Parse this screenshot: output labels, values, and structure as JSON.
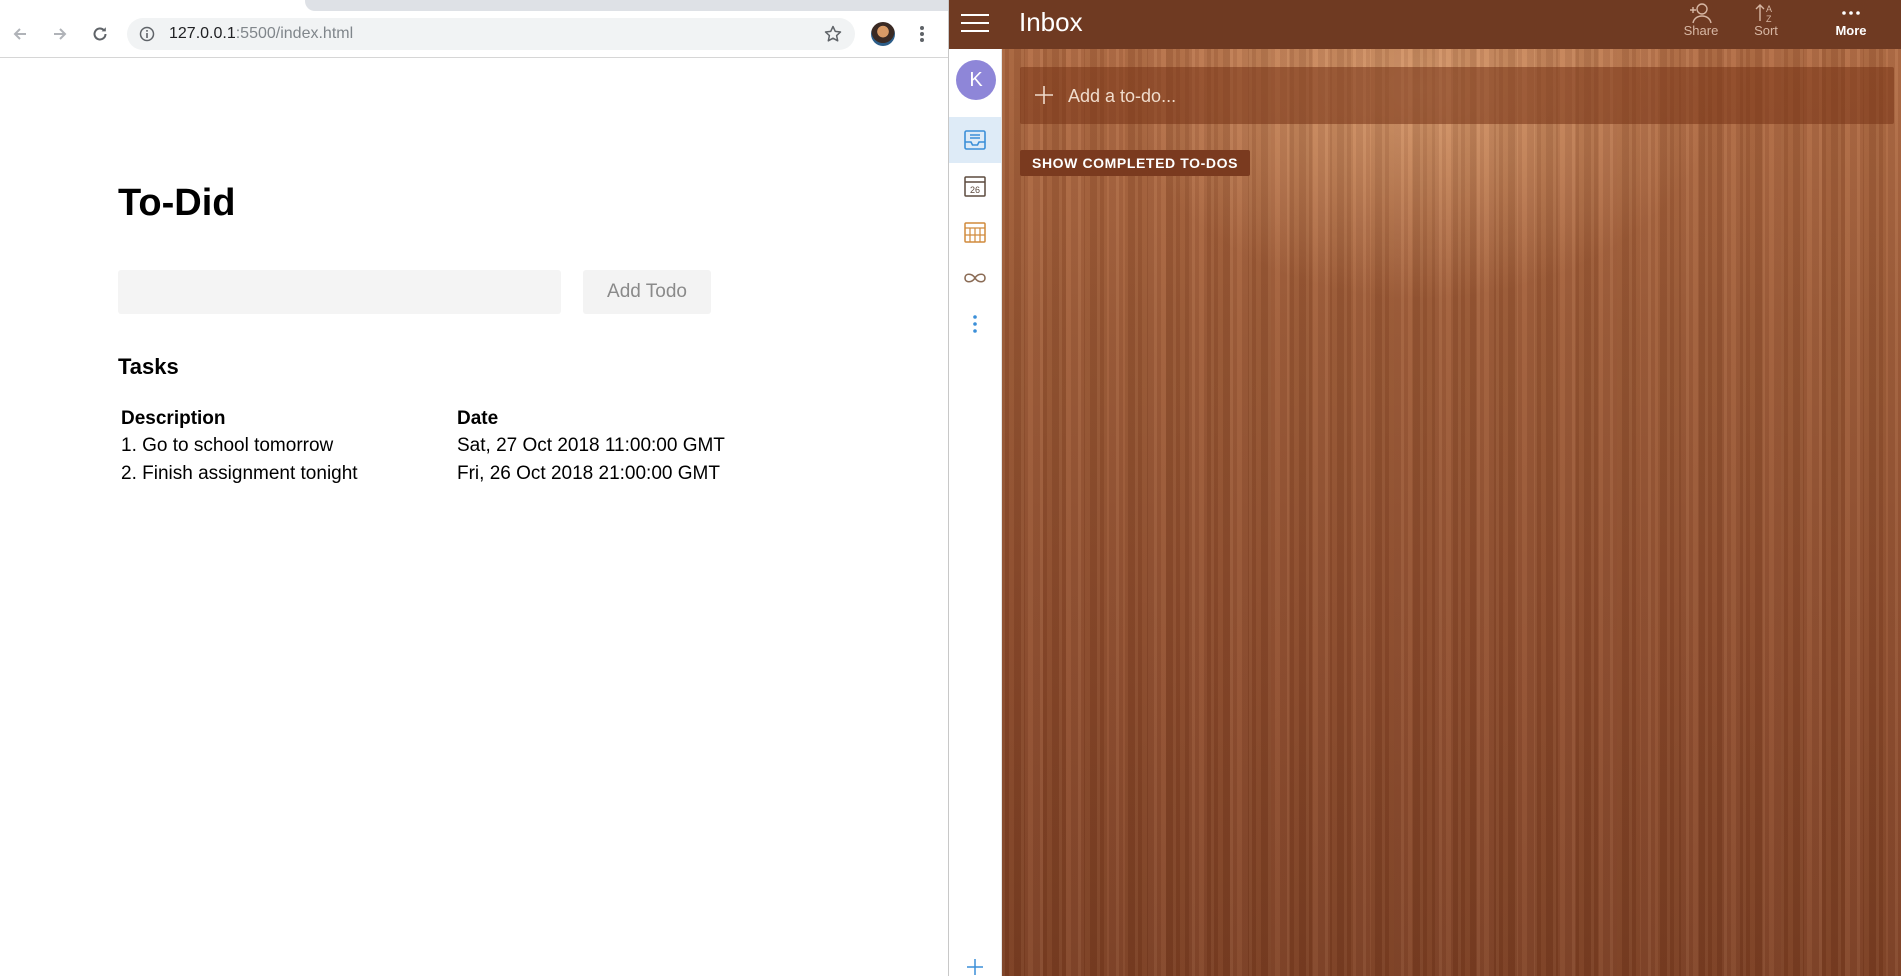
{
  "browser": {
    "url_host": "127.0.0.1",
    "url_rest": ":5500/index.html"
  },
  "page": {
    "title": "To-Did",
    "input_value": "",
    "add_button": "Add Todo",
    "tasks_heading": "Tasks",
    "columns": [
      "Description",
      "Date"
    ],
    "rows": [
      {
        "description": "1. Go to school tomorrow",
        "date": "Sat, 27 Oct 2018 11:00:00 GMT"
      },
      {
        "description": "2. Finish assignment tonight",
        "date": "Fri, 26 Oct 2018 21:00:00 GMT"
      }
    ]
  },
  "todo_app": {
    "title": "Inbox",
    "actions": {
      "share": "Share",
      "sort": "Sort",
      "more": "More"
    },
    "avatar_initial": "K",
    "add_placeholder": "Add a to-do...",
    "show_completed": "SHOW COMPLETED TO-DOS",
    "calendar_day": "26",
    "colors": {
      "appbar": "#6f3a22",
      "rail_active": "#deebf7",
      "avatar": "#8e86d8",
      "accent_blue": "#3b8fd8",
      "accent_orange": "#d08a3c"
    }
  }
}
